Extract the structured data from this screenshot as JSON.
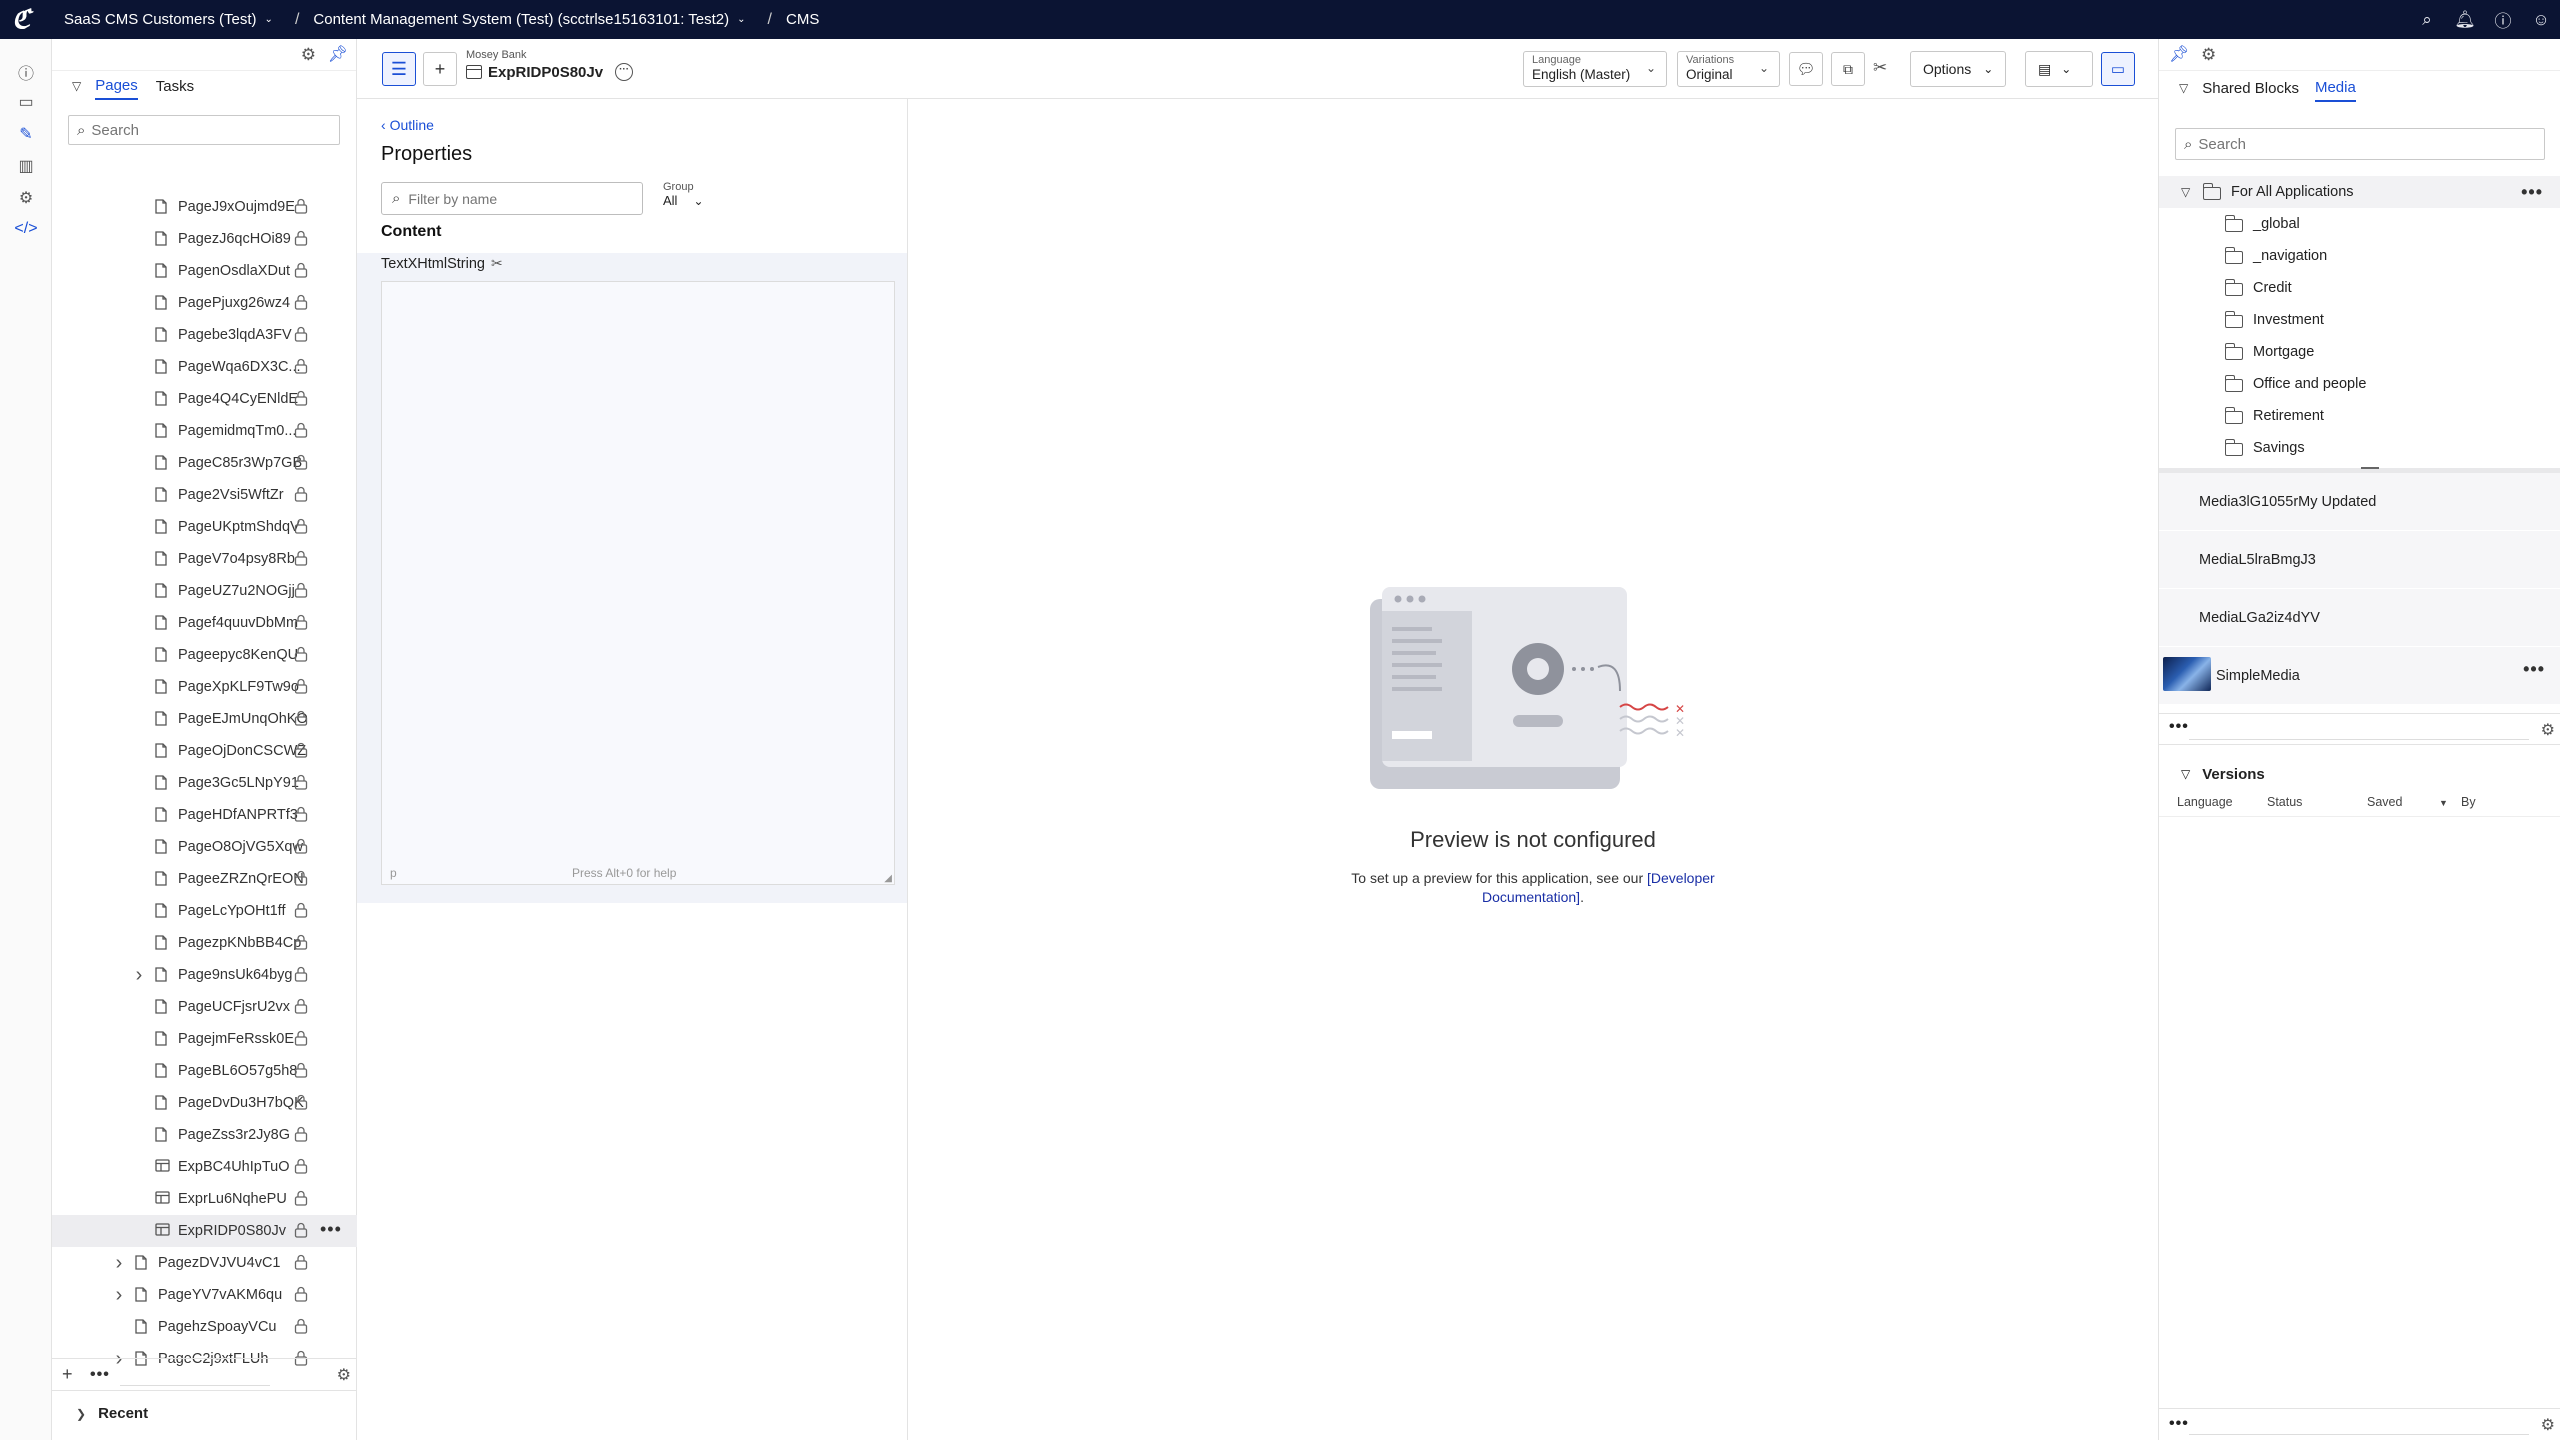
{
  "topbar": {
    "logo_icon": "optimizely-logo-icon",
    "crumbs": [
      {
        "label": "SaaS CMS Customers (Test)",
        "dropdown": true
      },
      {
        "label": "Content Management System (Test) (scctrlse15163101: Test2)",
        "dropdown": true
      },
      {
        "label": "CMS",
        "dropdown": false
      }
    ],
    "icons": [
      "search-icon",
      "bell-icon",
      "help-icon",
      "user-icon"
    ]
  },
  "rail": {
    "icons": [
      "info-icon",
      "folder-icon",
      "edit-icon",
      "reports-icon",
      "settings-icon",
      "code-icon"
    ],
    "active_index": 2
  },
  "tree": {
    "tabs": [
      "Pages",
      "Tasks"
    ],
    "active_tab": "Pages",
    "search_placeholder": "Search",
    "items": [
      {
        "label": "PageJ9xOujmd9E",
        "type": "page",
        "level": 2
      },
      {
        "label": "PagezJ6qcHOi89",
        "type": "page",
        "level": 2
      },
      {
        "label": "PagenOsdlaXDut",
        "type": "page",
        "level": 2
      },
      {
        "label": "PagePjuxg26wz4",
        "type": "page",
        "level": 2
      },
      {
        "label": "Pagebe3lqdA3FV",
        "type": "page",
        "level": 2
      },
      {
        "label": "PageWqa6DX3C...",
        "type": "page",
        "level": 2
      },
      {
        "label": "Page4Q4CyENldE",
        "type": "page",
        "level": 2
      },
      {
        "label": "PagemidmqTm0...",
        "type": "page",
        "level": 2
      },
      {
        "label": "PageC85r3Wp7GB",
        "type": "page",
        "level": 2
      },
      {
        "label": "Page2Vsi5WftZr",
        "type": "page",
        "level": 2
      },
      {
        "label": "PageUKptmShdqV",
        "type": "page",
        "level": 2
      },
      {
        "label": "PageV7o4psy8Rb",
        "type": "page",
        "level": 2
      },
      {
        "label": "PageUZ7u2NOGjj",
        "type": "page",
        "level": 2
      },
      {
        "label": "Pagef4quuvDbMm",
        "type": "page",
        "level": 2
      },
      {
        "label": "Pageepyc8KenQU",
        "type": "page",
        "level": 2
      },
      {
        "label": "PageXpKLF9Tw9o",
        "type": "page",
        "level": 2
      },
      {
        "label": "PageEJmUnqOhKO",
        "type": "page",
        "level": 2
      },
      {
        "label": "PageOjDonCSCWZ",
        "type": "page",
        "level": 2
      },
      {
        "label": "Page3Gc5LNpY91",
        "type": "page",
        "level": 2
      },
      {
        "label": "PageHDfANPRTf3",
        "type": "page",
        "level": 2
      },
      {
        "label": "PageO8OjVG5Xqw",
        "type": "page",
        "level": 2
      },
      {
        "label": "PageeZRZnQrEON",
        "type": "page",
        "level": 2
      },
      {
        "label": "PageLcYpOHt1ff",
        "type": "page",
        "level": 2
      },
      {
        "label": "PagezpKNbBB4Cp",
        "type": "page",
        "level": 2
      },
      {
        "label": "Page9nsUk64byg",
        "type": "page",
        "level": 2,
        "expandable": true
      },
      {
        "label": "PageUCFjsrU2vx",
        "type": "page",
        "level": 2
      },
      {
        "label": "PagejmFeRssk0E",
        "type": "page",
        "level": 2
      },
      {
        "label": "PageBL6O57g5h8",
        "type": "page",
        "level": 2
      },
      {
        "label": "PageDvDu3H7bQK",
        "type": "page",
        "level": 2
      },
      {
        "label": "PageZss3r2Jy8G",
        "type": "page",
        "level": 2
      },
      {
        "label": "ExpBC4UhIpTuO",
        "type": "experience",
        "level": 2
      },
      {
        "label": "ExprLu6NqhePU",
        "type": "experience",
        "level": 2
      },
      {
        "label": "ExpRIDP0S80Jv",
        "type": "experience",
        "level": 2,
        "selected": true
      },
      {
        "label": "PagezDVJVU4vC1",
        "type": "page",
        "level": 1,
        "expandable": true
      },
      {
        "label": "PageYV7vAKM6qu",
        "type": "page",
        "level": 1,
        "expandable": true
      },
      {
        "label": "PagehzSpoayVCu",
        "type": "page",
        "level": 1
      },
      {
        "label": "PageC2j9xtFLUh",
        "type": "page",
        "level": 1,
        "expandable": true
      }
    ],
    "recent_label": "Recent"
  },
  "editor": {
    "site": "Mosey Bank",
    "title": "ExpRIDP0S80Jv",
    "language_label": "Language",
    "language_value": "English (Master)",
    "variations_label": "Variations",
    "variations_value": "Original",
    "options_label": "Options"
  },
  "props": {
    "outline_link": "Outline",
    "heading": "Properties",
    "filter_placeholder": "Filter by name",
    "group_label": "Group",
    "group_value": "All",
    "section": "Content",
    "field_name": "TextXHtmlString",
    "editor_tag": "p",
    "editor_help": "Press Alt+0 for help"
  },
  "preview": {
    "title": "Preview is not configured",
    "message_prefix": "To set up a preview for this application, see our ",
    "link_text": "[Developer Documentation]",
    "message_suffix": "."
  },
  "right": {
    "tabs": [
      "Shared Blocks",
      "Media"
    ],
    "active_tab": "Media",
    "search_placeholder": "Search",
    "root_folder": "For All Applications",
    "folders": [
      "_global",
      "_navigation",
      "Credit",
      "Investment",
      "Mortgage",
      "Office and people",
      "Retirement",
      "Savings"
    ],
    "media": [
      {
        "label": "Media3lG1055rMy Updated",
        "thumb": false
      },
      {
        "label": "MediaL5lraBmgJ3",
        "thumb": false
      },
      {
        "label": "MediaLGa2iz4dYV",
        "thumb": false
      },
      {
        "label": "SimpleMedia",
        "thumb": true
      }
    ],
    "versions_heading": "Versions",
    "version_cols": [
      "Language",
      "Status",
      "Saved",
      "By"
    ]
  }
}
